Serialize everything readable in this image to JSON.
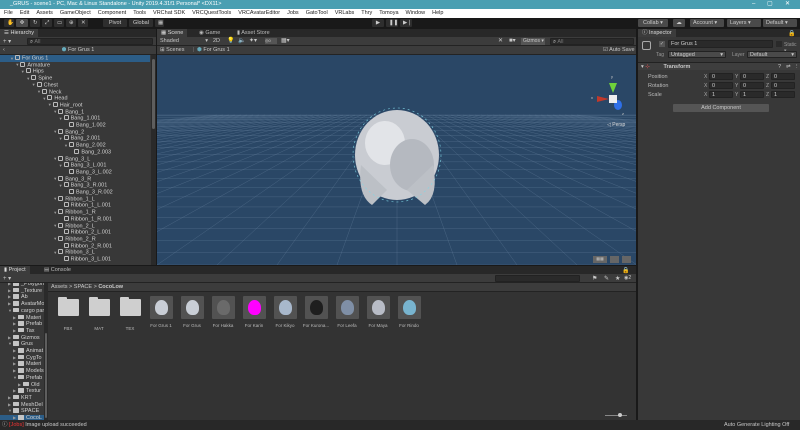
{
  "window": {
    "title": "_GRUS - scene1 - PC, Mac & Linux Standalone - Unity 2019.4.31f1 Personal* <DX11>",
    "minimize": "–",
    "maximize": "▢",
    "close": "✕"
  },
  "menu": [
    "File",
    "Edit",
    "Assets",
    "GameObject",
    "Component",
    "Tools",
    "VRChat SDK",
    "VRCQuestTools",
    "VRCAvatarEditor",
    "Jobs",
    "GatoTool",
    "VRLabs",
    "Thry",
    "Tomoya",
    "Window",
    "Help"
  ],
  "toolbar": {
    "pivot": "Pivot",
    "global": "Global",
    "play": "▶",
    "pause": "❚❚",
    "step": "▶❘",
    "collab": "Collab ▾",
    "cloud": "☁",
    "account": "Account",
    "layers": "Layers",
    "layout": "Default"
  },
  "hierarchy": {
    "tab": "Hierarchy",
    "search_placeholder": "All",
    "add": "+ ▾",
    "breadcrumb": "For Grus 1",
    "items": [
      {
        "label": "For Grus 1",
        "depth": 0,
        "expanded": true,
        "selected": true
      },
      {
        "label": "Armature",
        "depth": 1,
        "expanded": true
      },
      {
        "label": "Hips",
        "depth": 2,
        "expanded": true
      },
      {
        "label": "Spine",
        "depth": 3,
        "expanded": true
      },
      {
        "label": "Chest",
        "depth": 4,
        "expanded": true
      },
      {
        "label": "Neck",
        "depth": 5,
        "expanded": true
      },
      {
        "label": "Head",
        "depth": 6,
        "expanded": true
      },
      {
        "label": "Hair_root",
        "depth": 7,
        "expanded": true
      },
      {
        "label": "Bang_1",
        "depth": 8,
        "expanded": true
      },
      {
        "label": "Bang_1.001",
        "depth": 9,
        "expanded": true
      },
      {
        "label": "Bang_1.002",
        "depth": 10
      },
      {
        "label": "Bang_2",
        "depth": 8,
        "expanded": true
      },
      {
        "label": "Bang_2.001",
        "depth": 9,
        "expanded": true
      },
      {
        "label": "Bang_2.002",
        "depth": 10,
        "expanded": true
      },
      {
        "label": "Bang_2.003",
        "depth": 11
      },
      {
        "label": "Bang_3_L",
        "depth": 8,
        "expanded": true
      },
      {
        "label": "Bang_3_L.001",
        "depth": 9,
        "expanded": true
      },
      {
        "label": "Bang_3_L.002",
        "depth": 10
      },
      {
        "label": "Bang_3_R",
        "depth": 8,
        "expanded": true
      },
      {
        "label": "Bang_3_R.001",
        "depth": 9,
        "expanded": true
      },
      {
        "label": "Bang_3_R.002",
        "depth": 10
      },
      {
        "label": "Ribbon_1_L",
        "depth": 8,
        "expanded": true
      },
      {
        "label": "Ribbon_1_L.001",
        "depth": 9
      },
      {
        "label": "Ribbon_1_R",
        "depth": 8,
        "expanded": true
      },
      {
        "label": "Ribbon_1_R.001",
        "depth": 9
      },
      {
        "label": "Ribbon_2_L",
        "depth": 8,
        "expanded": true
      },
      {
        "label": "Ribbon_2_L.001",
        "depth": 9
      },
      {
        "label": "Ribbon_2_R",
        "depth": 8,
        "expanded": true
      },
      {
        "label": "Ribbon_2_R.001",
        "depth": 9
      },
      {
        "label": "Ribbon_3_L",
        "depth": 8,
        "expanded": true
      },
      {
        "label": "Ribbon_3_L.001",
        "depth": 9
      }
    ]
  },
  "scene": {
    "tabs": [
      "Scene",
      "Game",
      "Asset Store"
    ],
    "shading": "Shaded",
    "mode2d": "2D",
    "gizmos": "Gizmos",
    "search_placeholder": "All",
    "breadcrumb_root": "Scenes",
    "breadcrumb_item": "For Grus 1",
    "auto_save": "Auto Save",
    "persp": "◁ Persp",
    "axis_y": "y",
    "axis_x": "x",
    "axis_z": "z"
  },
  "inspector": {
    "tab": "Inspector",
    "name": "For Grus 1",
    "static": "Static ▾",
    "tag_label": "Tag",
    "tag": "Untagged",
    "layer_label": "Layer",
    "layer": "Default",
    "component": "Transform",
    "rows": [
      {
        "label": "Position",
        "x": "0",
        "y": "0",
        "z": "0"
      },
      {
        "label": "Rotation",
        "x": "0",
        "y": "0",
        "z": "0"
      },
      {
        "label": "Scale",
        "x": "1",
        "y": "1",
        "z": "1"
      }
    ],
    "add_component": "Add Component"
  },
  "project": {
    "tabs": [
      "Project",
      "Console"
    ],
    "add": "+ ▾",
    "breadcrumb": [
      "Assets",
      "SPACE",
      "CocoLow"
    ],
    "hidden_count": "2",
    "tree": [
      {
        "label": "_Polygonal",
        "depth": 1
      },
      {
        "label": "_Texture",
        "depth": 1
      },
      {
        "label": "Ab",
        "depth": 1
      },
      {
        "label": "AvatarMo",
        "depth": 1
      },
      {
        "label": "cargo par",
        "depth": 1,
        "expanded": true
      },
      {
        "label": "Materi",
        "depth": 2
      },
      {
        "label": "Prefab",
        "depth": 2
      },
      {
        "label": "Tax",
        "depth": 2
      },
      {
        "label": "Gizmos",
        "depth": 1
      },
      {
        "label": "Grus",
        "depth": 1,
        "expanded": true
      },
      {
        "label": "Animat",
        "depth": 2
      },
      {
        "label": "CygTo",
        "depth": 2
      },
      {
        "label": "Materi",
        "depth": 2
      },
      {
        "label": "Models",
        "depth": 2
      },
      {
        "label": "Prefab",
        "depth": 2,
        "expanded": true
      },
      {
        "label": "Old",
        "depth": 3
      },
      {
        "label": "Textur",
        "depth": 2
      },
      {
        "label": "KRT",
        "depth": 1
      },
      {
        "label": "MeshDel",
        "depth": 1
      },
      {
        "label": "SPACE",
        "depth": 1,
        "expanded": true
      },
      {
        "label": "CocoL",
        "depth": 2,
        "selected": true
      }
    ],
    "assets": [
      {
        "label": "FBX",
        "kind": "folder"
      },
      {
        "label": "MAT",
        "kind": "folder"
      },
      {
        "label": "TEX",
        "kind": "folder"
      },
      {
        "label": "For Grus 1",
        "kind": "prefab",
        "color": "#c9ced6"
      },
      {
        "label": "For Grus",
        "kind": "prefab",
        "color": "#c9ced6"
      },
      {
        "label": "For Hakka",
        "kind": "prefab",
        "color": "#6a6a6a"
      },
      {
        "label": "For Karin",
        "kind": "prefab",
        "color": "#ff00ff"
      },
      {
        "label": "For Kikyo",
        "kind": "prefab",
        "color": "#a8b8cc"
      },
      {
        "label": "For Kurona...",
        "kind": "prefab",
        "color": "#1e1e1e"
      },
      {
        "label": "For Leefa",
        "kind": "prefab",
        "color": "#7f8fa6"
      },
      {
        "label": "For Maya",
        "kind": "prefab",
        "color": "#b8bcc6"
      },
      {
        "label": "For Rindo",
        "kind": "prefab",
        "color": "#78b4cf"
      }
    ]
  },
  "status": {
    "tag": "[Jobs]",
    "message": "Image upload succeeded",
    "lighting": "Auto Generate Lighting Off"
  }
}
